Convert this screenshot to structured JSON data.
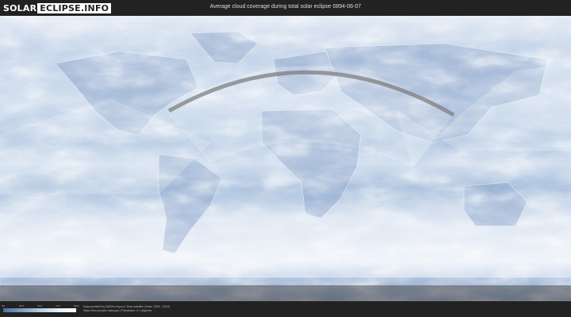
{
  "header": {
    "logo_part1": "SOLAR",
    "logo_part2": "ECLIPSE.INFO",
    "title": "Average cloud coverage during total solar eclipse 0894-06-07"
  },
  "legend": {
    "ticks": [
      "0%",
      "25%",
      "50%",
      "75%",
      "100%"
    ],
    "colors": [
      "#4a6fa5",
      "#7f9cc4",
      "#b8cae0",
      "#e6eef7",
      "#ffffff"
    ]
  },
  "footer": {
    "credit_line1": "Data provided by NASA's Aqua & Terra satellite (Years: 2000 - 2019)",
    "credit_line2": "https://neo.sci.gsfc.nasa.gov | Resolution: 0.1 degrees"
  }
}
